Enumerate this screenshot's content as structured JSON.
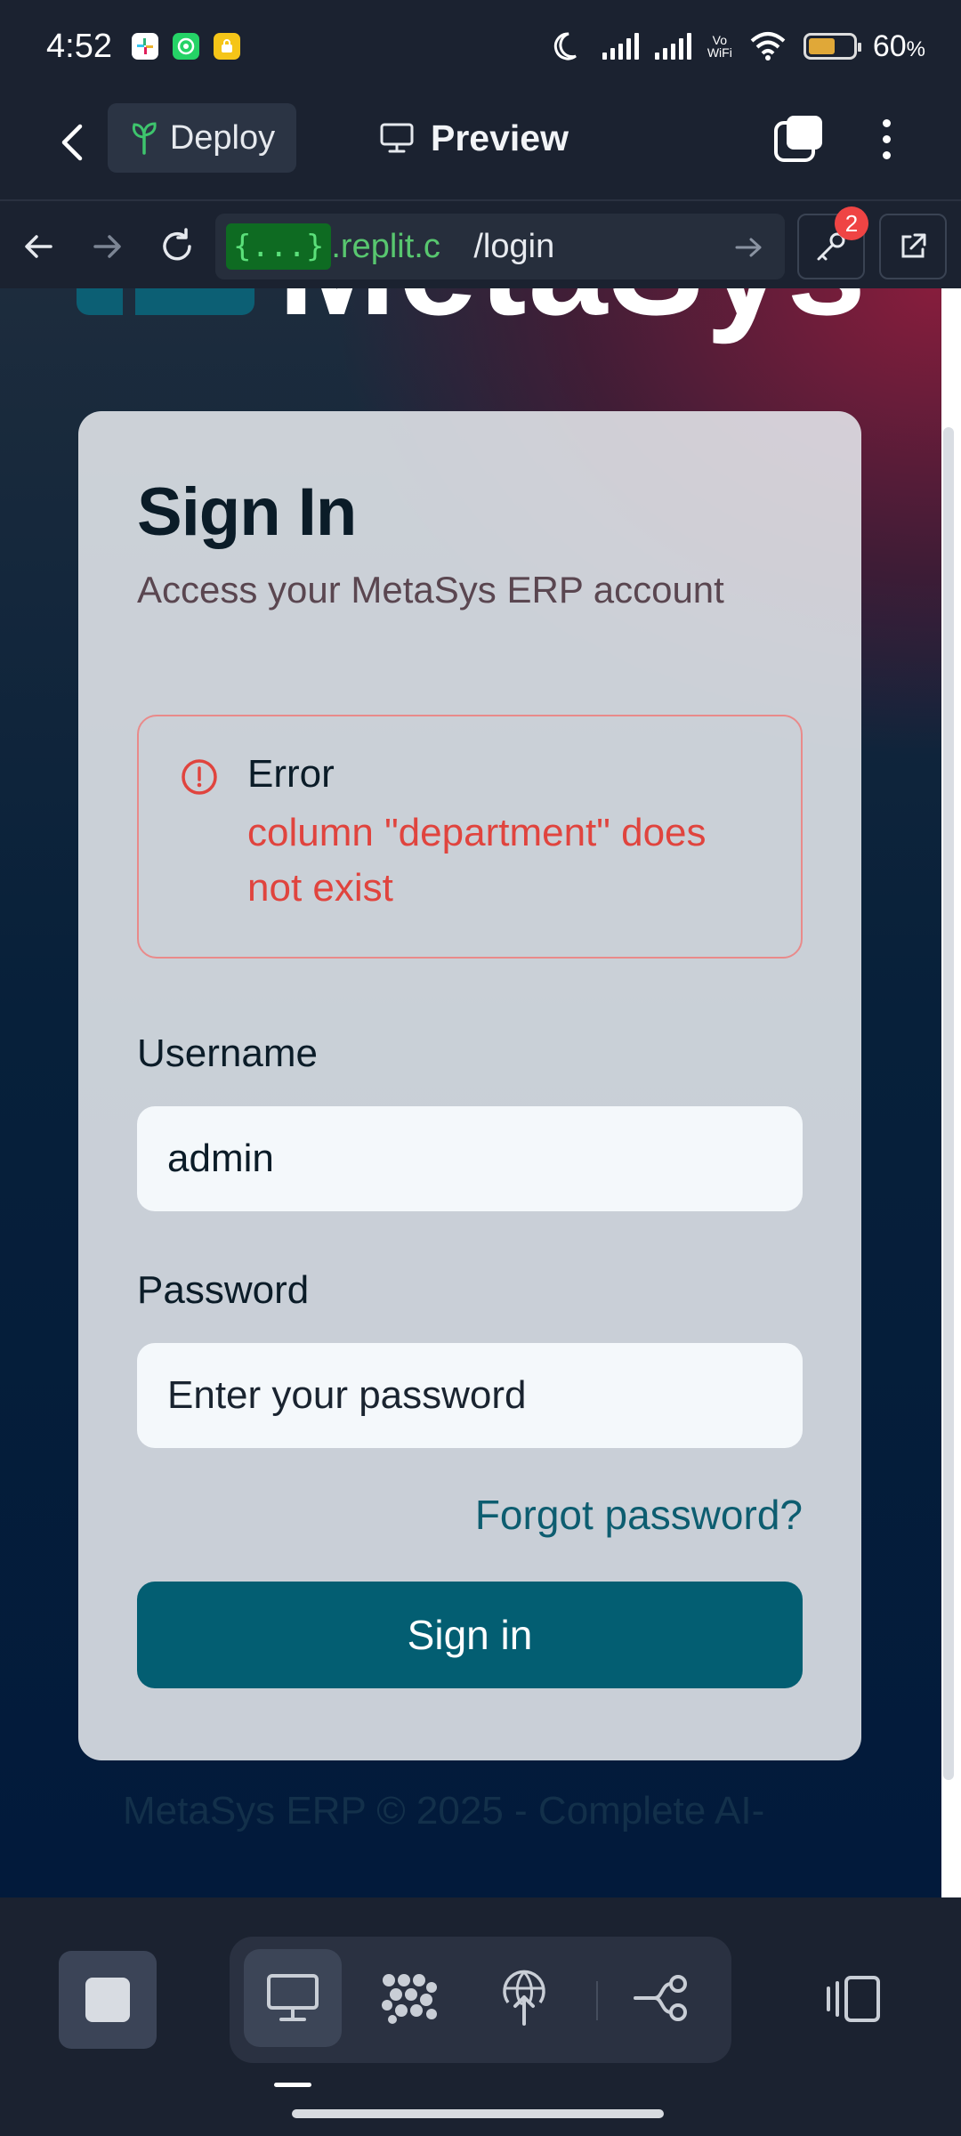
{
  "status_bar": {
    "time": "4:52",
    "vowifi_top": "Vo",
    "vowifi_bottom": "WiFi",
    "battery_pct": "60",
    "battery_unit": "%",
    "battery_level": 0.6
  },
  "header": {
    "deploy_label": "Deploy",
    "preview_label": "Preview"
  },
  "url_bar": {
    "host_mask": "{...}",
    "domain": ".replit.c",
    "path": "/login",
    "badge_count": "2"
  },
  "page": {
    "logo_text": "MetaSys",
    "signin": {
      "title": "Sign In",
      "subtitle": "Access your MetaSys ERP account",
      "error": {
        "title": "Error",
        "message": "column \"department\" does not exist"
      },
      "username_label": "Username",
      "username_value": "admin",
      "password_label": "Password",
      "password_placeholder": "Enter your password",
      "forgot_label": "Forgot password?",
      "submit_label": "Sign in"
    },
    "footer": "MetaSys ERP © 2025 - Complete AI-"
  },
  "icons": [
    "back-arrow-icon",
    "sprout-icon",
    "monitor-icon",
    "tabs-icon",
    "more-vertical-icon",
    "arrow-left-icon",
    "arrow-right-icon",
    "reload-icon",
    "arrow-go-icon",
    "key-icon",
    "external-link-icon",
    "alert-circle-icon",
    "stop-icon",
    "desktop-icon",
    "dots-grid-icon",
    "network-upload-icon",
    "git-branch-icon",
    "devices-icon"
  ],
  "colors": {
    "accent": "#035e72",
    "error": "#e0443e",
    "replit_green": "#58c76f"
  }
}
